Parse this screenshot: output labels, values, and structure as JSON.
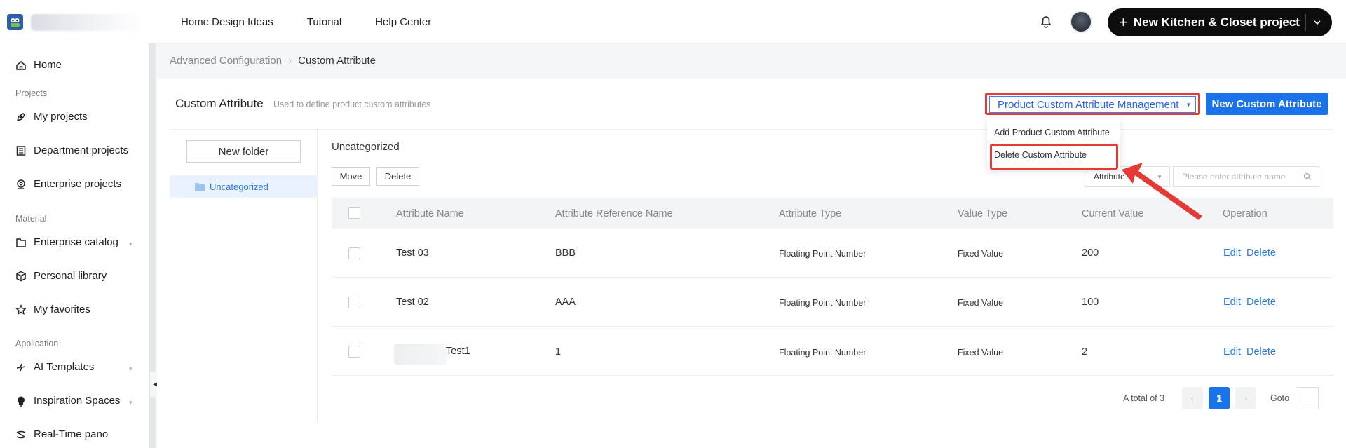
{
  "topnav": {
    "items": [
      "Home Design Ideas",
      "Tutorial",
      "Help Center"
    ],
    "new_project_label": "New Kitchen & Closet project"
  },
  "sidebar": {
    "items": [
      {
        "label": "Home",
        "icon": "home-icon"
      },
      {
        "section": "Projects"
      },
      {
        "label": "My projects",
        "icon": "project-icon"
      },
      {
        "label": "Department projects",
        "icon": "department-icon"
      },
      {
        "label": "Enterprise projects",
        "icon": "enterprise-icon"
      },
      {
        "section": "Material"
      },
      {
        "label": "Enterprise catalog",
        "icon": "catalog-icon"
      },
      {
        "label": "Personal library",
        "icon": "box-icon"
      },
      {
        "label": "My favorites",
        "icon": "star-icon"
      },
      {
        "section": "Application"
      },
      {
        "label": "AI Templates",
        "icon": "bolt-icon"
      },
      {
        "label": "Inspiration Spaces",
        "icon": "bulb-icon"
      },
      {
        "label": "Real-Time pano",
        "icon": "pano-icon"
      }
    ]
  },
  "breadcrumb": {
    "parent": "Advanced Configuration",
    "current": "Custom Attribute"
  },
  "page": {
    "title": "Custom Attribute",
    "subtitle": "Used to define product custom attributes"
  },
  "toolbar": {
    "product_mgmt_label": "Product Custom Attribute Management",
    "new_attr_label": "New Custom Attribute"
  },
  "dropdown": {
    "items": [
      "Add Product Custom Attribute",
      "Delete Custom Attribute"
    ]
  },
  "folders": {
    "new_folder_label": "New folder",
    "items": [
      "Uncategorized"
    ]
  },
  "list": {
    "title": "Uncategorized",
    "move_label": "Move",
    "delete_label": "Delete",
    "filter_value": "Attribute",
    "search_placeholder": "Please enter attribute name",
    "columns": [
      "Attribute Name",
      "Attribute Reference Name",
      "Attribute Type",
      "Value Type",
      "Current Value",
      "Operation"
    ],
    "rows": [
      {
        "name": "Test 03",
        "ref": "BBB",
        "type": "Floating Point Number",
        "value_type": "Fixed Value",
        "current": "200",
        "edit": "Edit",
        "delete": "Delete"
      },
      {
        "name": "Test 02",
        "ref": "AAA",
        "type": "Floating Point Number",
        "value_type": "Fixed Value",
        "current": "100",
        "edit": "Edit",
        "delete": "Delete"
      },
      {
        "name": "Test1",
        "ref": "1",
        "type": "Floating Point Number",
        "value_type": "Fixed Value",
        "current": "2",
        "edit": "Edit",
        "delete": "Delete"
      }
    ]
  },
  "pagination": {
    "total_text": "A total of 3",
    "current_page": "1",
    "prev": "‹",
    "next": "›",
    "goto_label": "Goto"
  },
  "colors": {
    "accent": "#1a73e8",
    "highlight": "#e53935"
  }
}
